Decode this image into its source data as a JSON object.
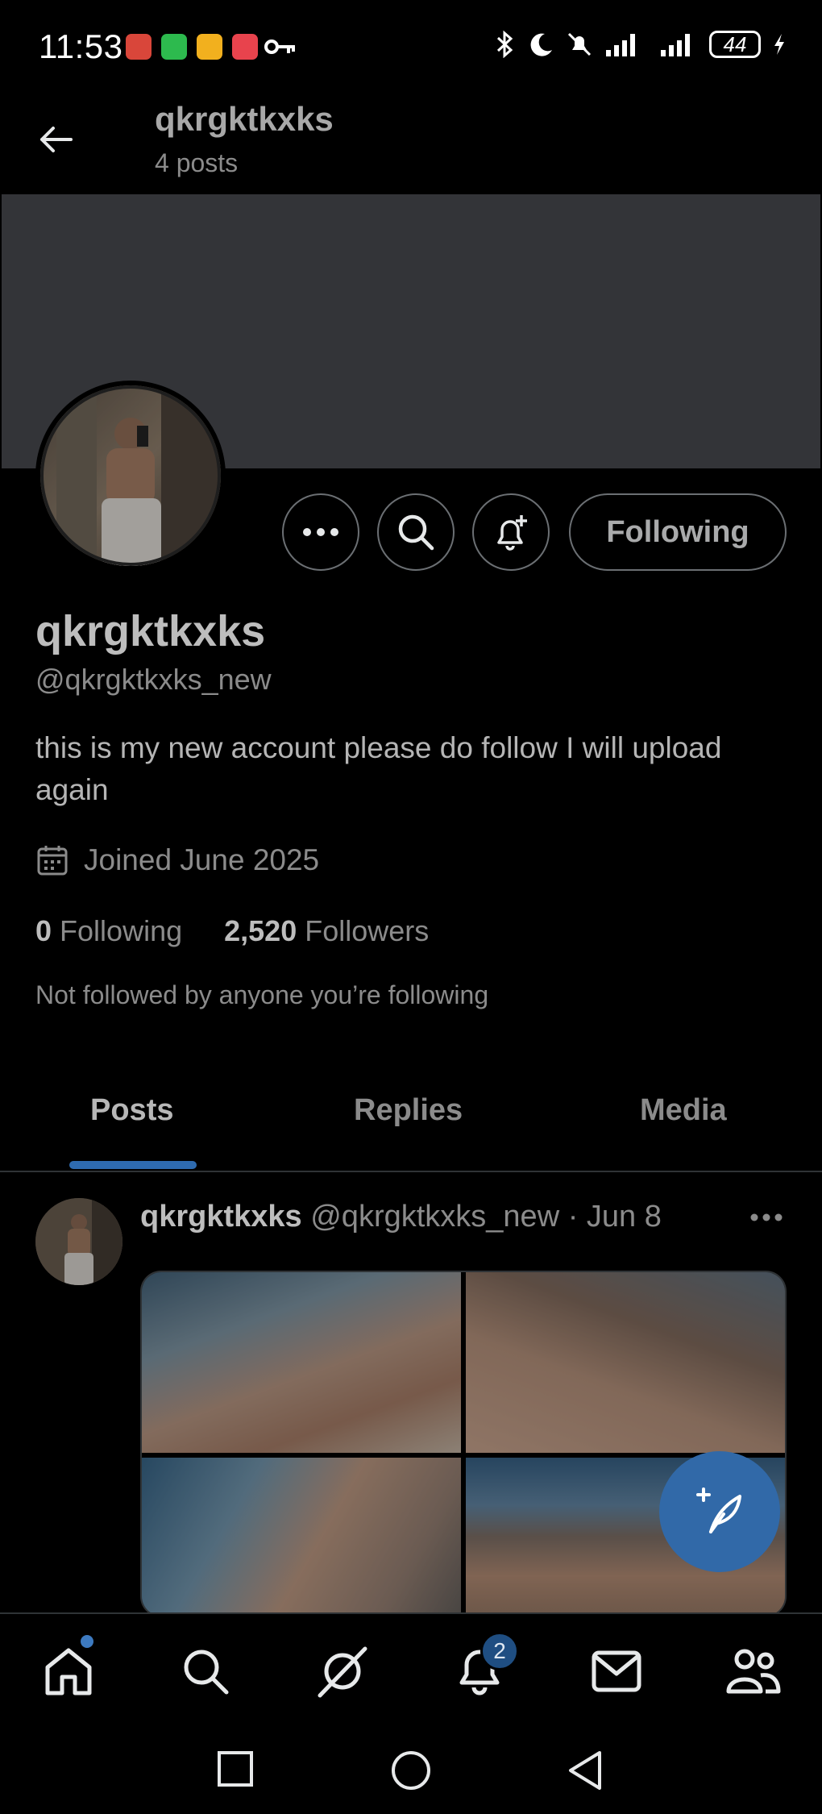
{
  "status_bar": {
    "time": "11:53",
    "battery": "44"
  },
  "header": {
    "title": "qkrgktkxks",
    "subtitle": "4 posts"
  },
  "profile": {
    "actions": {
      "following_label": "Following"
    },
    "display_name": "qkrgktkxks",
    "handle": "@qkrgktkxks_new",
    "bio": "this is my new account please do follow I will upload again",
    "joined": "Joined June 2025",
    "following_count": "0",
    "following_label": "Following",
    "followers_count": "2,520",
    "followers_label": "Followers",
    "not_followed_text": "Not followed by anyone you’re following"
  },
  "tabs": [
    {
      "label": "Posts",
      "active": true
    },
    {
      "label": "Replies",
      "active": false
    },
    {
      "label": "Media",
      "active": false
    }
  ],
  "post": {
    "author": "qkrgktkxks",
    "handle": "@qkrgktkxks_new",
    "date": "· Jun 8",
    "media_count": 4
  },
  "bottom_nav": {
    "items": [
      "home-icon",
      "search-icon",
      "grok-icon",
      "notifications-icon",
      "messages-icon",
      "communities-icon"
    ],
    "notifications_badge": "2"
  },
  "colors": {
    "accent": "#3169a8",
    "background": "#000000",
    "banner": "#333438"
  }
}
